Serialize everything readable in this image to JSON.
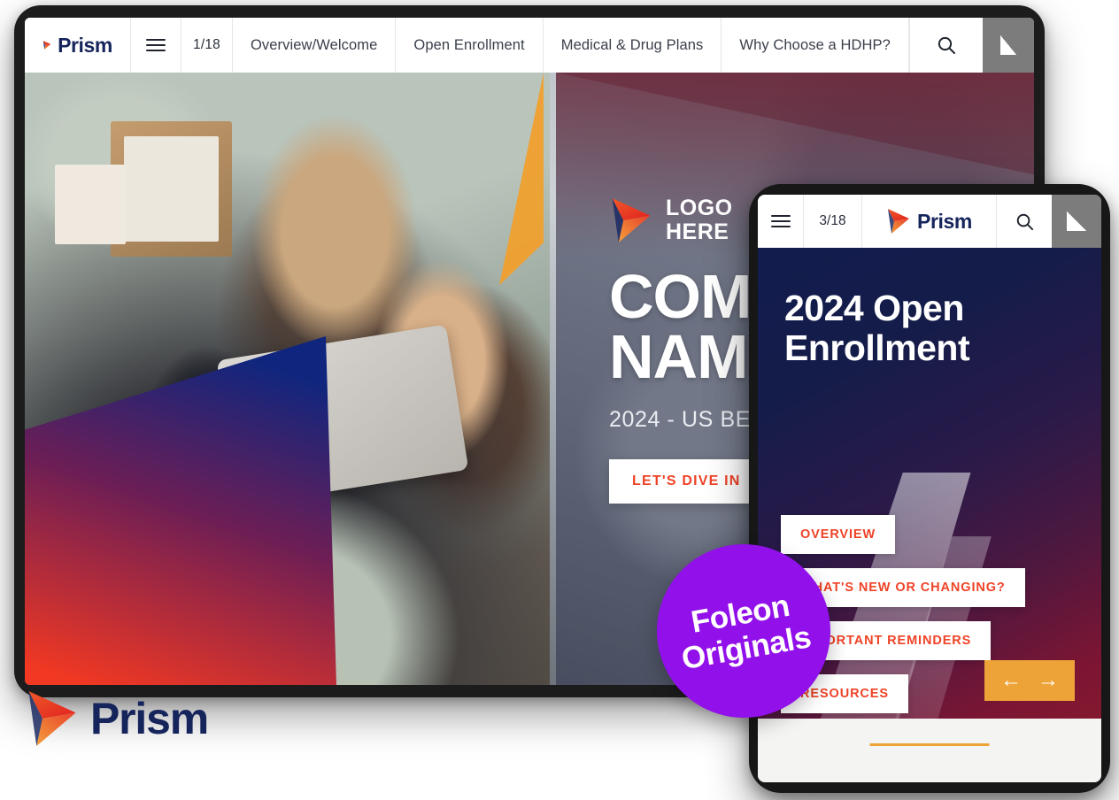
{
  "brand": {
    "name": "Prism",
    "logo_icon": "prism-logo-icon"
  },
  "tablet": {
    "topbar": {
      "burger_icon": "hamburger-menu-icon",
      "page_indicator": "1/18",
      "tabs": [
        {
          "label": "Overview/Welcome"
        },
        {
          "label": "Open Enrollment"
        },
        {
          "label": "Medical & Drug Plans"
        },
        {
          "label": "Why Choose a HDHP?"
        }
      ],
      "search_icon": "search-icon",
      "flip_icon": "fullscreen-flip-icon"
    },
    "hero": {
      "logo_placeholder_line1": "LOGO",
      "logo_placeholder_line2": "HERE",
      "logo_icon": "prism-logo-icon",
      "title_line1": "COMPANY",
      "title_line2": "NAME",
      "subtitle": "2024 - US BENEFITS",
      "cta_label": "LET'S DIVE IN"
    }
  },
  "mobile": {
    "topbar": {
      "burger_icon": "hamburger-menu-icon",
      "page_indicator": "3/18",
      "logo_text": "Prism",
      "search_icon": "search-icon",
      "flip_icon": "fullscreen-flip-icon"
    },
    "title": "2024 Open Enrollment",
    "menu_items": [
      {
        "label": "OVERVIEW"
      },
      {
        "label": "WHAT'S NEW OR CHANGING?"
      },
      {
        "label": "IMPORTANT REMINDERS"
      },
      {
        "label": "RESOURCES"
      }
    ],
    "nav": {
      "prev_icon": "arrow-left-icon",
      "prev": "←",
      "next_icon": "arrow-right-icon",
      "next": "→"
    }
  },
  "badge": {
    "line1": "Foleon",
    "line2": "Originals"
  },
  "colors": {
    "accent_red": "#EF4327",
    "brand_navy": "#16245C",
    "badge_purple": "#9210EA",
    "nav_orange": "#EDA338",
    "flip_gray": "#7C7C7C"
  }
}
